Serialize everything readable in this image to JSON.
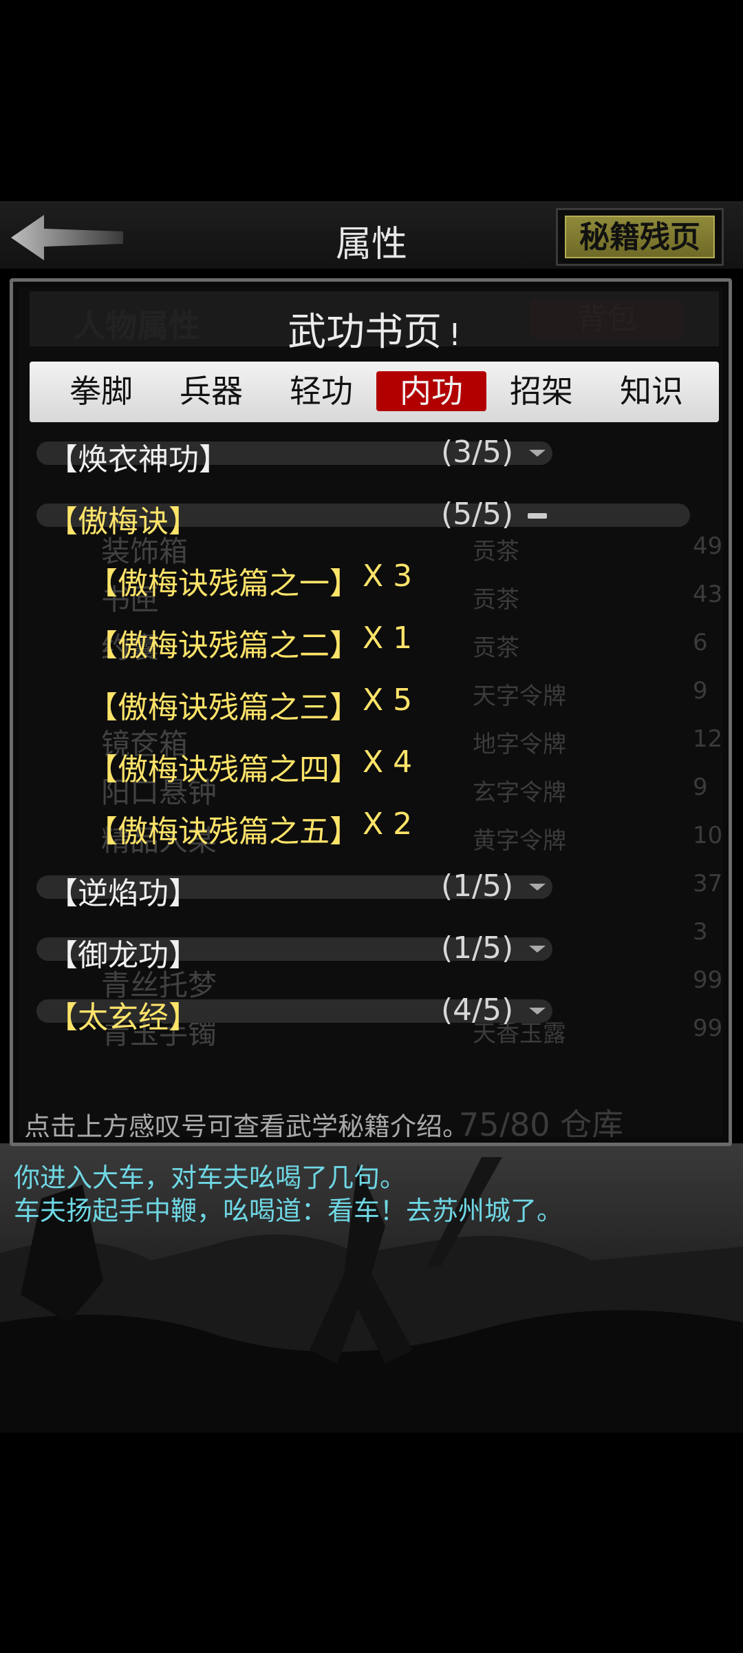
{
  "header": {
    "title": "属性",
    "fragments_button": "秘籍残页"
  },
  "background_layer": {
    "left_tab": "人物属性",
    "right_tab": "背包",
    "items": [
      {
        "name": "装饰箱",
        "cost_type": "贡茶",
        "qty": "49"
      },
      {
        "name": "书匣",
        "cost_type": "贡茶",
        "qty": "43"
      },
      {
        "name": "约囊",
        "cost_type": "贡茶",
        "qty": "6"
      },
      {
        "name": "",
        "cost_type": "天字令牌",
        "qty": "9"
      },
      {
        "name": "镜奁箱",
        "cost_type": "地字令牌",
        "qty": "12"
      },
      {
        "name": "阳口悬钟",
        "cost_type": "玄字令牌",
        "qty": "9"
      },
      {
        "name": "精品人某",
        "cost_type": "黄字令牌",
        "qty": "10"
      },
      {
        "name": "",
        "cost_type": "",
        "qty": "37"
      },
      {
        "name": "",
        "cost_type": "",
        "qty": "3"
      },
      {
        "name": "青丝托梦",
        "cost_type": "",
        "qty": "99"
      },
      {
        "name": "青玉手镯",
        "cost_type": "天香玉露",
        "qty": "99"
      }
    ],
    "footer_right": "75/80 仓库"
  },
  "section": {
    "title": "武功书页",
    "info_mark": "!"
  },
  "tabs": [
    {
      "label": "拳脚",
      "active": false
    },
    {
      "label": "兵器",
      "active": false
    },
    {
      "label": "轻功",
      "active": false
    },
    {
      "label": "内功",
      "active": true
    },
    {
      "label": "招架",
      "active": false
    },
    {
      "label": "知识",
      "active": false
    }
  ],
  "skills": [
    {
      "name": "【焕衣神功】",
      "count": "(3/5)",
      "expanded": false,
      "color": "white"
    },
    {
      "name": "【傲梅诀】",
      "count": "(5/5)",
      "expanded": true,
      "color": "yellow",
      "fragments": [
        {
          "name": "【傲梅诀残篇之一】",
          "qty": "X 3"
        },
        {
          "name": "【傲梅诀残篇之二】",
          "qty": "X 1"
        },
        {
          "name": "【傲梅诀残篇之三】",
          "qty": "X 5"
        },
        {
          "name": "【傲梅诀残篇之四】",
          "qty": "X 4"
        },
        {
          "name": "【傲梅诀残篇之五】",
          "qty": "X 2"
        }
      ]
    },
    {
      "name": "【逆焰功】",
      "count": "(1/5)",
      "expanded": false,
      "color": "white"
    },
    {
      "name": "【御龙功】",
      "count": "(1/5)",
      "expanded": false,
      "color": "white"
    },
    {
      "name": "【太玄经】",
      "count": "(4/5)",
      "expanded": false,
      "color": "yellow"
    }
  ],
  "hint": "点击上方感叹号可查看武学秘籍介绍。",
  "chat": [
    "你进入大车，对车夫吆喝了几句。",
    "车夫扬起手中鞭，吆喝道：看车！去苏州城了。"
  ]
}
